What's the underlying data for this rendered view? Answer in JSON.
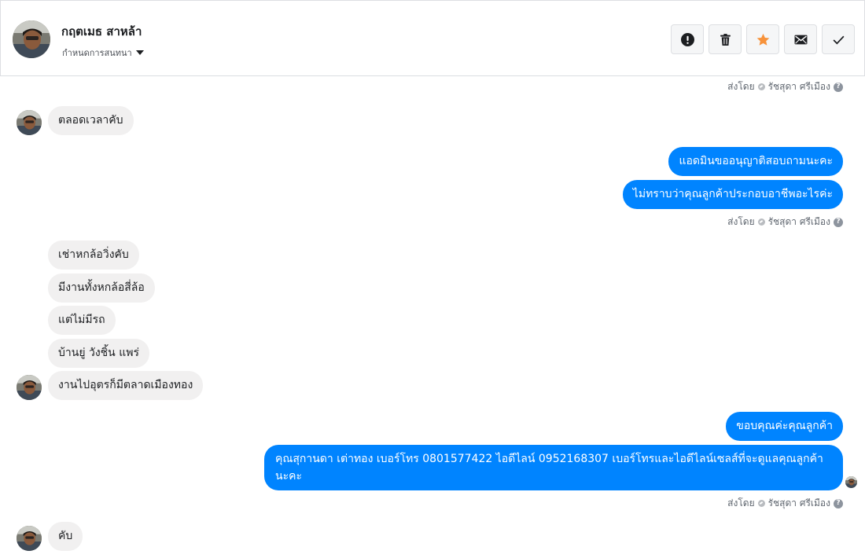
{
  "header": {
    "contact_name": "กฤตเมธ สาหล้า",
    "assign_label": "กำหนดการสนทนา",
    "toolbar": {
      "spam_icon": "exclamation-circle-icon",
      "delete_icon": "trash-icon",
      "star_icon": "star-icon",
      "unread_icon": "envelope-icon",
      "done_icon": "check-icon"
    }
  },
  "colors": {
    "outgoing_bubble": "#0084ff",
    "incoming_bubble": "#f1f0f0",
    "star": "#f7923a"
  },
  "sent_by": {
    "prefix": "ส่งโดย",
    "name": "รัชสุดา ศรีเมือง",
    "help": "?"
  },
  "messages": {
    "m1": "ตลอดเวลาคับ",
    "m2": "แอดมินขออนุญาติสอบถามนะคะ",
    "m3": "ไม่ทราบว่าคุณลูกค้าประกอบอาชีพอะไรค่ะ",
    "m4": "เช่าหกล้อวิ่งคับ",
    "m5": "มีงานทั้งหกล้อสี่ล้อ",
    "m6": "แต่ไม่มีรถ",
    "m7": "บ้านยู่ วังชิ้น แพร่",
    "m8": "งานไปอุตรก็มีตลาดเมืองทอง",
    "m9": "ขอบคุณค่ะคุณลูกค้า",
    "m10": "คุณสุกานดา เต่าทอง      เบอร์โทร 0801577422  ไอดีไลน์ 0952168307  เบอร์โทรและไอดีไลน์เซลส์ที่จะดูแลคุณลูกค้านะคะ",
    "m11": "คับ"
  }
}
